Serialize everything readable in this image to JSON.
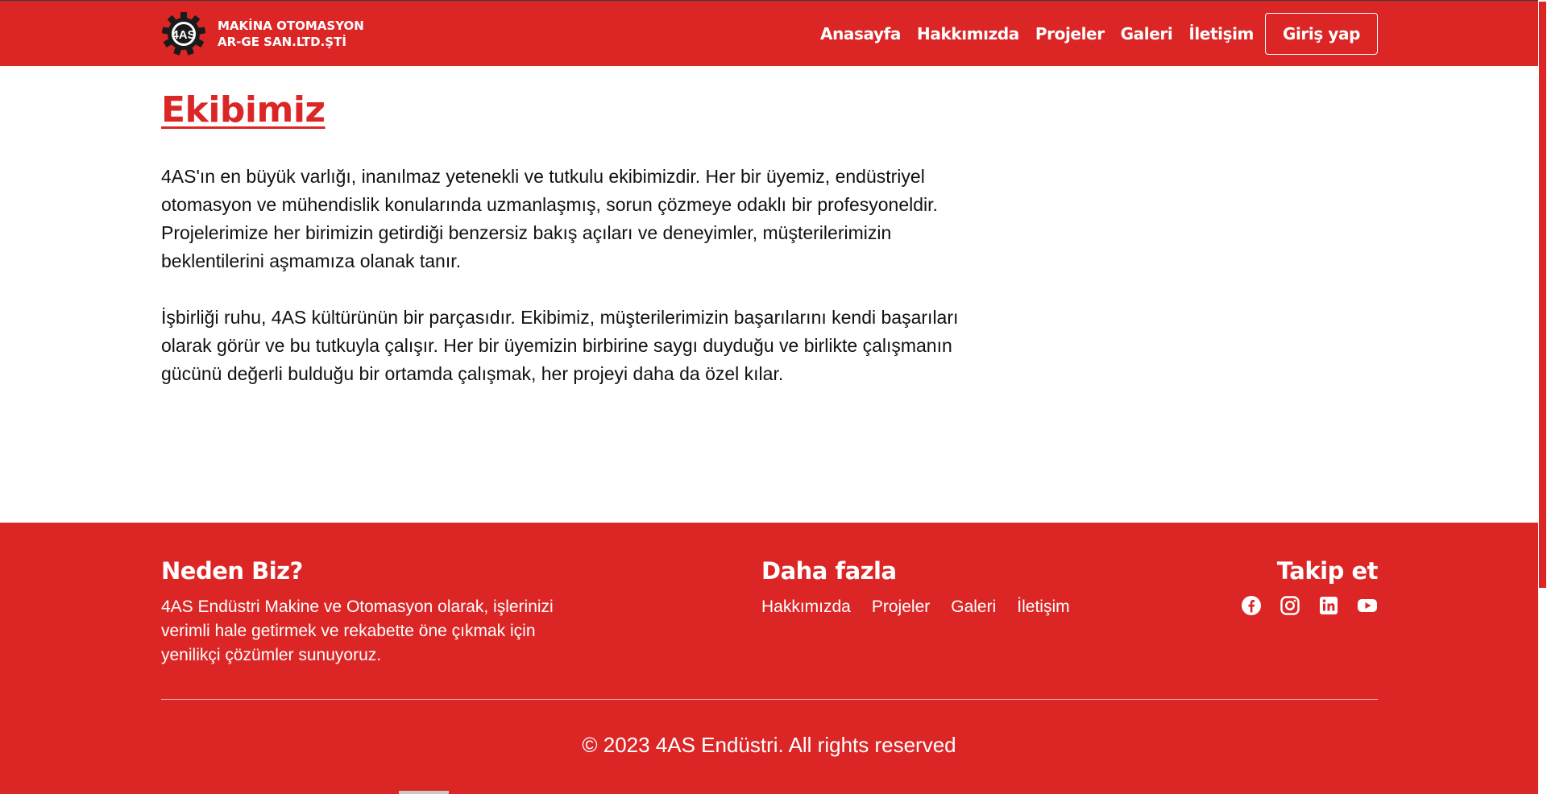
{
  "header": {
    "logo_text_line1": "MAKİNA OTOMASYON",
    "logo_text_line2": "AR-GE SAN.LTD.ŞTİ",
    "logo_mark": "4AS",
    "nav": [
      "Anasayfa",
      "Hakkımızda",
      "Projeler",
      "Galeri",
      "İletişim"
    ],
    "login_label": "Giriş yap"
  },
  "main": {
    "title": "Ekibimiz",
    "paragraphs": [
      "4AS'ın en büyük varlığı, inanılmaz yetenekli ve tutkulu ekibimizdir. Her bir üyemiz, endüstriyel otomasyon ve mühendislik konularında uzmanlaşmış, sorun çözmeye odaklı bir profesyoneldir. Projelerimize her birimizin getirdiği benzersiz bakış açıları ve deneyimler, müşterilerimizin beklentilerini aşmamıza olanak tanır.",
      "İşbirliği ruhu, 4AS kültürünün bir parçasıdır. Ekibimiz, müşterilerimizin başarılarını kendi başarıları olarak görür ve bu tutkuyla çalışır. Her bir üyemizin birbirine saygı duyduğu ve birlikte çalışmanın gücünü değerli bulduğu bir ortamda çalışmak, her projeyi daha da özel kılar."
    ]
  },
  "footer": {
    "why_heading": "Neden Biz?",
    "why_text": "4AS Endüstri Makine ve Otomasyon olarak, işlerinizi verimli hale getirmek ve rekabette öne çıkmak için yenilikçi çözümler sunuyoruz.",
    "more_heading": "Daha fazla",
    "more_links": [
      "Hakkımızda",
      "Projeler",
      "Galeri",
      "İletişim"
    ],
    "follow_heading": "Takip et",
    "social_icons": [
      "facebook-icon",
      "instagram-icon",
      "linkedin-icon",
      "youtube-icon"
    ],
    "copyright": "© 2023 4AS Endüstri. All rights reserved"
  },
  "colors": {
    "brand_red": "#dc2626",
    "text_dark": "#111111",
    "white": "#ffffff"
  }
}
